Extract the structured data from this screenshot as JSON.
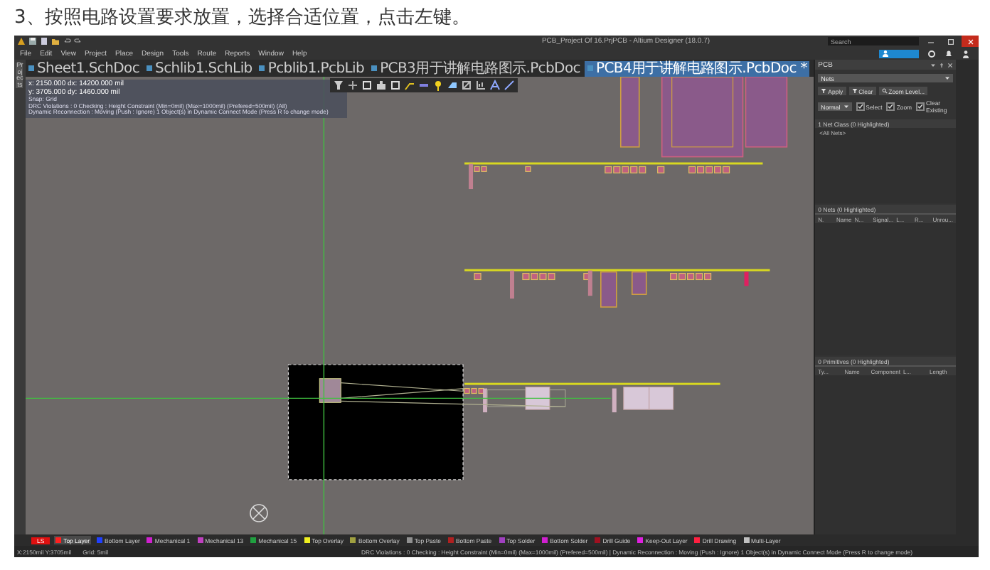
{
  "caption": "3、按照电路设置要求放置，选择合适位置，点击左键。",
  "window": {
    "title": "PCB_Project Of 16.PrjPCB - Altium Designer (18.0.7)"
  },
  "search": {
    "placeholder": "Search"
  },
  "menu": [
    "File",
    "Edit",
    "View",
    "Project",
    "Place",
    "Design",
    "Tools",
    "Route",
    "Reports",
    "Window",
    "Help"
  ],
  "side_tab": "Projects",
  "doc_tabs": [
    {
      "label": "Sheet1.SchDoc",
      "selected": false
    },
    {
      "label": "Schlib1.SchLib",
      "selected": false
    },
    {
      "label": "Pcblib1.PcbLib",
      "selected": false
    },
    {
      "label": "PCB3用于讲解电路图示.PcbDoc",
      "selected": false
    },
    {
      "label": "PCB4用于讲解电路图示.PcbDoc *",
      "selected": true
    }
  ],
  "hud": [
    "x: 2150.000   dx: 14200.000 mil",
    "y: 3705.000   dy: 1460.000 mil",
    "Snap: Grid",
    "DRC Violations : 0 Checking : Height Constraint (Min=0mil) (Max=1000mil) (Prefered=500mil) (All)",
    "Dynamic Reconnection : Moving (Push : Ignore) 1 Object(s) in Dynamic Connect Mode (Press R to change mode)"
  ],
  "panel": {
    "title": "PCB",
    "mode": "Nets",
    "buttons": [
      "Apply",
      "Clear",
      "Zoom Level..."
    ],
    "highlight_mode": "Normal",
    "options": [
      {
        "label": "Select",
        "checked": true
      },
      {
        "label": "Zoom",
        "checked": true
      },
      {
        "label": "Clear Existing",
        "checked": true
      }
    ],
    "net_class_header": "1 Net Class (0 Highlighted)",
    "net_classes": [
      "<All Nets>"
    ],
    "nets_header": "0 Nets (0 Highlighted)",
    "nets_columns": [
      "N.",
      "Name",
      "N...",
      "Signal...",
      "L...",
      "R...",
      "Unrou..."
    ],
    "primitives_header": "0 Primitives (0 Highlighted)",
    "primitives_columns": [
      "Ty...",
      "Name",
      "Component",
      "L...",
      "Length"
    ]
  },
  "layer_set": "LS",
  "layers": [
    {
      "label": "Top Layer",
      "color": "#ff2020",
      "selected": true
    },
    {
      "label": "Bottom Layer",
      "color": "#2040ff",
      "selected": false
    },
    {
      "label": "Mechanical 1",
      "color": "#d020d0",
      "selected": false
    },
    {
      "label": "Mechanical 13",
      "color": "#c040c0",
      "selected": false
    },
    {
      "label": "Mechanical 15",
      "color": "#20a040",
      "selected": false
    },
    {
      "label": "Top Overlay",
      "color": "#f0f020",
      "selected": false
    },
    {
      "label": "Bottom Overlay",
      "color": "#a0a040",
      "selected": false
    },
    {
      "label": "Top Paste",
      "color": "#909090",
      "selected": false
    },
    {
      "label": "Bottom Paste",
      "color": "#b02020",
      "selected": false
    },
    {
      "label": "Top Solder",
      "color": "#a040c0",
      "selected": false
    },
    {
      "label": "Bottom Solder",
      "color": "#d020d0",
      "selected": false
    },
    {
      "label": "Drill Guide",
      "color": "#a01020",
      "selected": false
    },
    {
      "label": "Keep-Out Layer",
      "color": "#e020e0",
      "selected": false
    },
    {
      "label": "Drill Drawing",
      "color": "#ff2040",
      "selected": false
    },
    {
      "label": "Multi-Layer",
      "color": "#c0c0c0",
      "selected": false
    }
  ],
  "status_bar": {
    "position": "X:2150mil Y:3705mil",
    "grid": "Grid: 5mil",
    "message": "DRC Violations : 0 Checking : Height Constraint (Min=0mil) (Max=1000mil) (Prefered=500mil) | Dynamic Reconnection : Moving (Push : Ignore) 1 Object(s) in Dynamic Connect Mode (Press R to change mode)"
  }
}
